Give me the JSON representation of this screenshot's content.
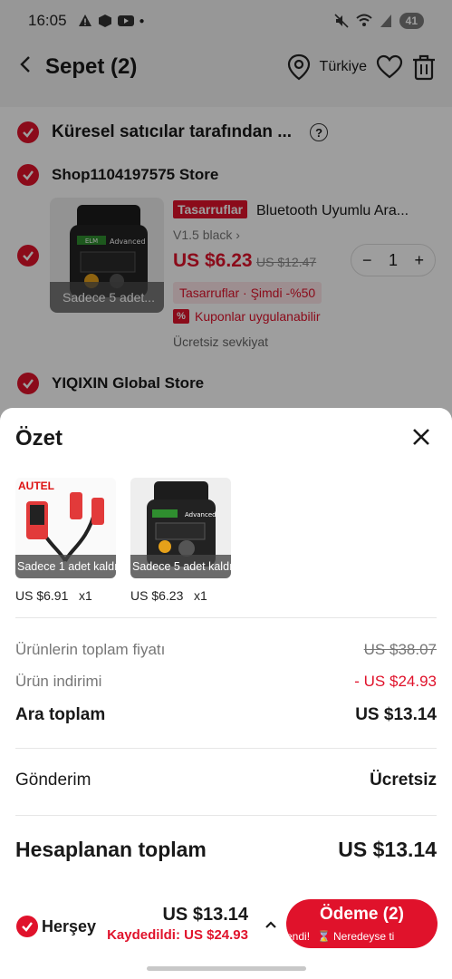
{
  "status_bar": {
    "time": "16:05",
    "battery": "41"
  },
  "header": {
    "title": "Sepet (2)",
    "location": "Türkiye"
  },
  "cart": {
    "global_sellers": "Küresel satıcılar tarafından ...",
    "stores": [
      {
        "name": "Shop1104197575 Store"
      },
      {
        "name": "YIQIXIN Global Store"
      }
    ],
    "item": {
      "tag": "Tasarruflar",
      "title": "Bluetooth Uyumlu Ara...",
      "variant": "V1.5 black",
      "price": "US $6.23",
      "old_price": "US $12.47",
      "quantity": "1",
      "promo": "Tasarruflar · Şimdi -%50",
      "coupon": "Kuponlar uygulanabilir",
      "shipping": "Ücretsiz sevkiyat",
      "stock_badge": "Sadece 5 adet..."
    }
  },
  "summary": {
    "title": "Özet",
    "items": [
      {
        "badge": "Sadece 1 adet kaldı",
        "price": "US $6.91",
        "qty": "x1"
      },
      {
        "badge": "Sadece 5 adet kaldı",
        "price": "US $6.23",
        "qty": "x1"
      }
    ],
    "rows": {
      "total_label": "Ürünlerin toplam fiyatı",
      "total_value": "US $38.07",
      "discount_label": "Ürün indirimi",
      "discount_value": "- US $24.93",
      "subtotal_label": "Ara toplam",
      "subtotal_value": "US $13.14",
      "shipping_label": "Gönderim",
      "shipping_value": "Ücretsiz",
      "calc_label": "Hesaplanan toplam",
      "calc_value": "US $13.14"
    }
  },
  "bottom": {
    "select_all": "Herşey",
    "amount": "US $13.14",
    "saved": "Kaydedildi: US $24.93",
    "pay_label": "Ödeme (2)",
    "pay_sub_left": "endi!",
    "pay_sub_right": "Neredeyse ti"
  },
  "colors": {
    "accent": "#e0122b"
  }
}
